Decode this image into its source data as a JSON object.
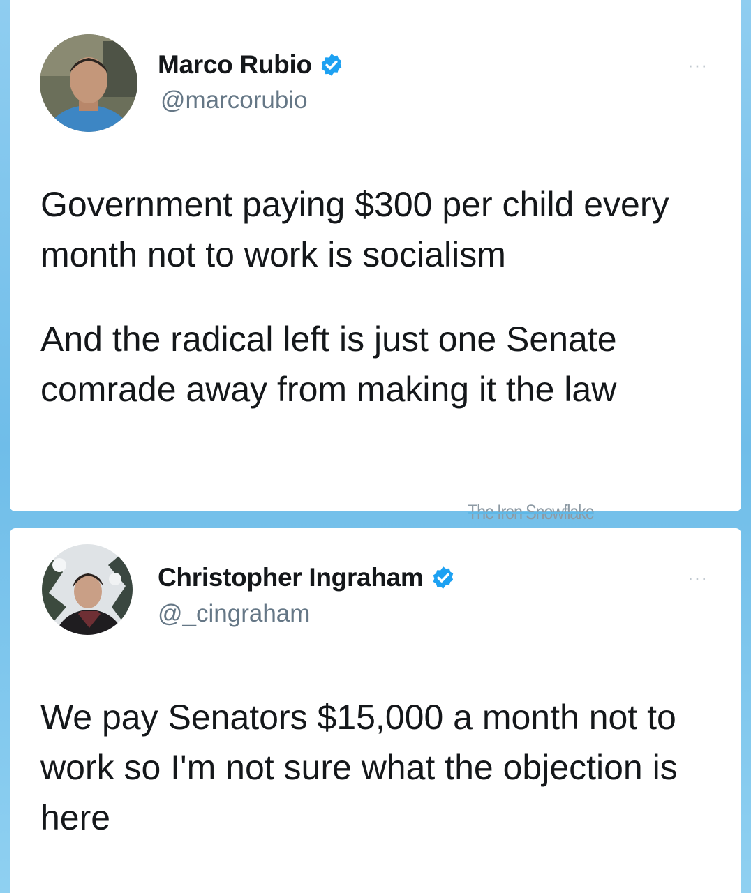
{
  "tweets": [
    {
      "display_name": "Marco Rubio",
      "handle": "@marcorubio",
      "verified": true,
      "paragraphs": [
        "Government paying $300 per child every month not to work is socialism",
        "And the radical left is just one Senate comrade away from making it the law"
      ],
      "more_label": "···"
    },
    {
      "display_name": "Christopher Ingraham",
      "handle": "@_cingraham",
      "verified": true,
      "paragraphs": [
        "We pay Senators $15,000 a month not to work so I'm not sure what the objection is here"
      ],
      "more_label": "···"
    }
  ],
  "watermark": "The Iron Snowflake",
  "colors": {
    "background": "#7cc6ec",
    "card": "#ffffff",
    "verified": "#1da1f2",
    "handle": "#657786",
    "text": "#14171a"
  },
  "icons": {
    "verified": "verified-badge-icon",
    "more": "more-options-icon"
  }
}
